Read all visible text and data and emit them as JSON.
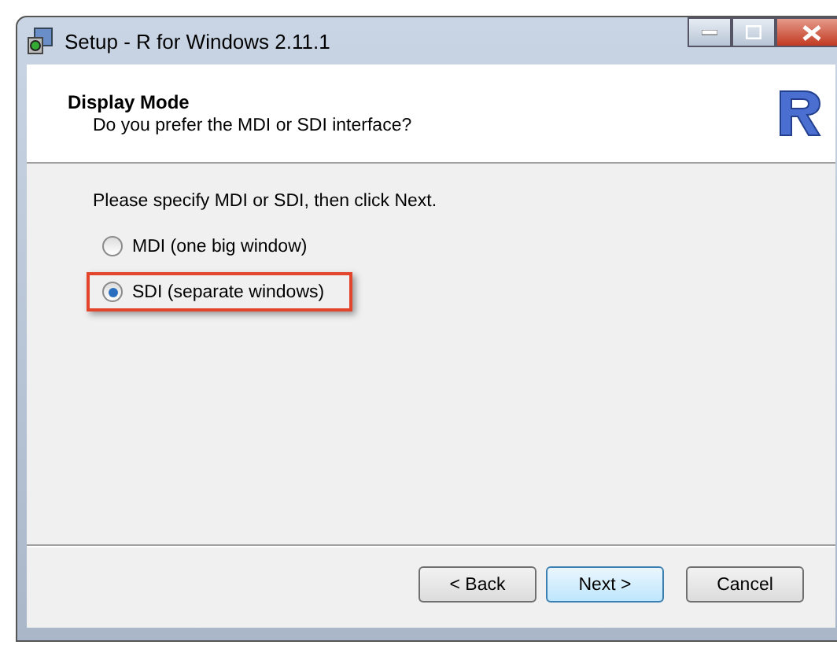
{
  "window": {
    "title": "Setup - R for Windows 2.11.1"
  },
  "header": {
    "title": "Display Mode",
    "subtitle": "Do you prefer the MDI or SDI interface?"
  },
  "instruction": "Please specify MDI or SDI, then click Next.",
  "options": [
    {
      "label": "MDI (one big window)",
      "selected": false,
      "highlighted": false
    },
    {
      "label": "SDI (separate windows)",
      "selected": true,
      "highlighted": true
    }
  ],
  "buttons": [
    {
      "label": "< Back",
      "default": false
    },
    {
      "label": "Next >",
      "default": true
    },
    {
      "label": "Cancel",
      "default": false
    }
  ]
}
